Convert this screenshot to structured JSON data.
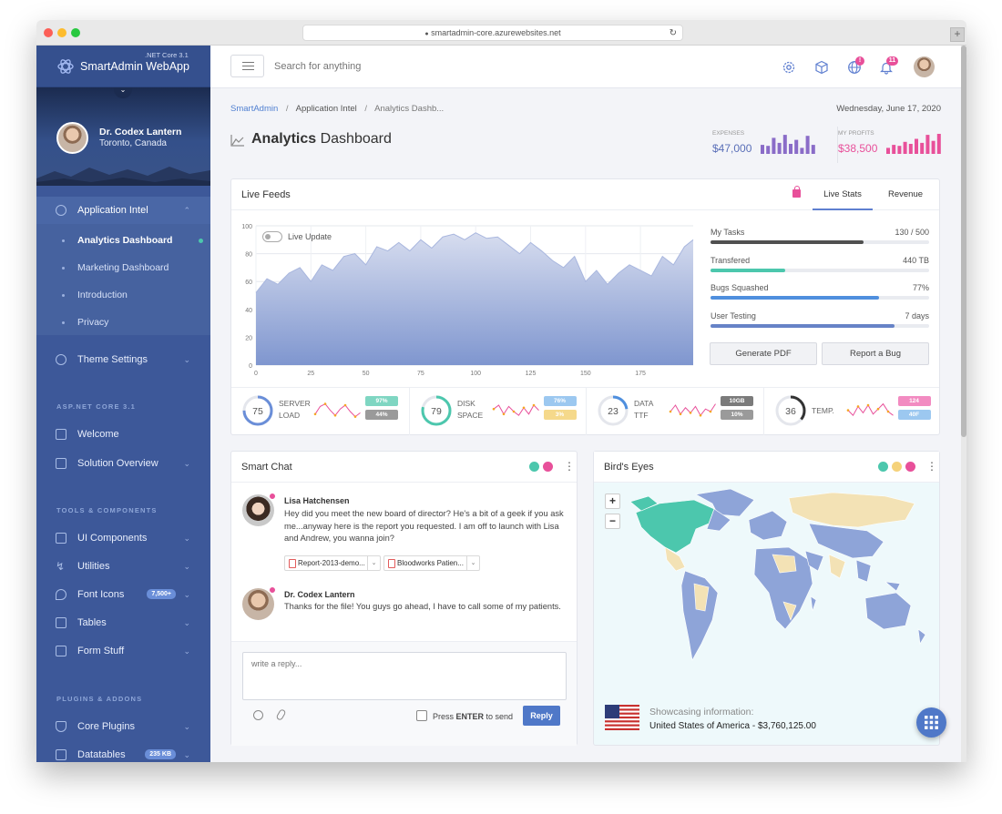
{
  "browser": {
    "url": "smartadmin-core.azurewebsites.net"
  },
  "app": {
    "name": "SmartAdmin WebApp",
    "version": ".NET Core 3.1"
  },
  "user": {
    "name": "Dr. Codex Lantern",
    "location": "Toronto, Canada"
  },
  "sidebar": {
    "app_intel": "Application Intel",
    "subs": [
      "Analytics Dashboard",
      "Marketing Dashboard",
      "Introduction",
      "Privacy"
    ],
    "theme": "Theme Settings",
    "section1": "ASP.NET CORE 3.1",
    "welcome": "Welcome",
    "solution": "Solution Overview",
    "section2": "TOOLS & COMPONENTS",
    "ui": "UI Components",
    "utilities": "Utilities",
    "fonticons": "Font Icons",
    "fonticons_badge": "7,500+",
    "tables": "Tables",
    "formstuff": "Form Stuff",
    "section3": "PLUGINS & ADDONS",
    "coreplugins": "Core Plugins",
    "datatables": "Datatables",
    "datatables_badge": "235 KB"
  },
  "topbar": {
    "search_placeholder": "Search for anything",
    "globe_badge": "!",
    "bell_badge": "11"
  },
  "breadcrumb": {
    "root": "SmartAdmin",
    "section": "Application Intel",
    "current": "Analytics Dashb..."
  },
  "date": "Wednesday, June 17, 2020",
  "page": {
    "title_bold": "Analytics",
    "title_light": "Dashboard"
  },
  "header_stats": {
    "expenses_label": "EXPENSES",
    "expenses_value": "$47,000",
    "expenses_color": "#8a6cc8",
    "profits_label": "MY PROFITS",
    "profits_value": "$38,500",
    "profits_color": "#e8509a",
    "expenses_bars": [
      0.45,
      0.4,
      0.8,
      0.55,
      0.95,
      0.5,
      0.7,
      0.3,
      0.9,
      0.45
    ],
    "profits_bars": [
      0.3,
      0.45,
      0.4,
      0.6,
      0.5,
      0.75,
      0.55,
      0.95,
      0.65,
      1.0
    ]
  },
  "livefeeds": {
    "title": "Live Feeds",
    "tab_stats": "Live Stats",
    "tab_revenue": "Revenue",
    "live_update": "Live Update",
    "stats": [
      {
        "label": "My Tasks",
        "value": "130 / 500",
        "pct": 0.7,
        "color": "#505050"
      },
      {
        "label": "Transfered",
        "value": "440 TB",
        "pct": 0.34,
        "color": "#4cc7ad"
      },
      {
        "label": "Bugs Squashed",
        "value": "77%",
        "pct": 0.77,
        "color": "#4f8fde"
      },
      {
        "label": "User Testing",
        "value": "7 days",
        "pct": 0.84,
        "color": "#6683c7"
      }
    ],
    "btn_pdf": "Generate PDF",
    "btn_bug": "Report a Bug"
  },
  "chart_data": {
    "type": "area",
    "x": [
      0,
      5,
      10,
      15,
      20,
      25,
      30,
      35,
      40,
      45,
      50,
      55,
      60,
      65,
      70,
      75,
      80,
      85,
      90,
      95,
      100,
      105,
      110,
      115,
      120,
      125,
      130,
      135,
      140,
      145,
      150,
      155,
      160,
      165,
      170,
      175,
      180,
      185,
      190,
      195,
      199
    ],
    "y": [
      52,
      62,
      58,
      66,
      70,
      60,
      72,
      68,
      78,
      80,
      72,
      85,
      82,
      88,
      82,
      90,
      84,
      92,
      94,
      90,
      95,
      91,
      92,
      86,
      80,
      88,
      82,
      75,
      70,
      78,
      60,
      68,
      58,
      66,
      72,
      68,
      64,
      78,
      72,
      85,
      90
    ],
    "ylim": [
      0,
      100
    ],
    "xlim": [
      0,
      199
    ],
    "yticks": [
      0,
      20,
      40,
      60,
      80,
      100
    ],
    "xticks": [
      0,
      25,
      50,
      75,
      100,
      125,
      150,
      175
    ]
  },
  "gauges": [
    {
      "value": "75",
      "label1": "SERVER",
      "label2": "LOAD",
      "color": "#6a8ed8",
      "tag1": "97%",
      "tag1c": "#7fd6c2",
      "tag2": "44%",
      "tag2c": "#9a9a9a",
      "pct": 0.75,
      "spark": [
        12,
        6,
        4,
        9,
        13,
        8,
        5,
        10,
        14,
        11
      ]
    },
    {
      "value": "79",
      "label1": "DISK",
      "label2": "SPACE",
      "color": "#4cc7ad",
      "tag1": "76%",
      "tag1c": "#9cc8f0",
      "tag2": "3%",
      "tag2c": "#f5d98b",
      "pct": 0.79,
      "spark": [
        8,
        5,
        12,
        6,
        10,
        13,
        7,
        12,
        5,
        9
      ]
    },
    {
      "value": "23",
      "label1": "DATA",
      "label2": "TTF",
      "color": "#4f8fde",
      "tag1": "10GB",
      "tag1c": "#7b7b7b",
      "tag2": "10%",
      "tag2c": "#9a9a9a",
      "pct": 0.23,
      "spark": [
        10,
        5,
        12,
        7,
        11,
        6,
        13,
        8,
        10,
        4
      ]
    },
    {
      "value": "36",
      "label1": "TEMP.",
      "label2": "",
      "color": "#333333",
      "tag1": "124",
      "tag1c": "#f28bc1",
      "tag2": "40F",
      "tag2c": "#9cc8f0",
      "pct": 0.36,
      "spark": [
        9,
        13,
        6,
        11,
        5,
        12,
        8,
        4,
        10,
        13
      ]
    }
  ],
  "chat": {
    "title": "Smart Chat",
    "messages": [
      {
        "name": "Lisa Hatchensen",
        "lines": [
          "Hey did you meet the new board of director? He's a bit of a geek if you ask",
          "me...anyway here is the report you requested. I am off to launch with Lisa",
          "and Andrew, you wanna join?"
        ]
      },
      {
        "name": "Dr. Codex Lantern",
        "lines": [
          "Thanks for the file! You guys go ahead, I have to call some of my patients."
        ]
      }
    ],
    "att1": "Report-2013-demo...",
    "att2": "Bloodworks Patien...",
    "placeholder": "write a reply...",
    "press_enter": "Press ENTER to send",
    "enter_word": "ENTER",
    "reply": "Reply"
  },
  "map": {
    "title": "Bird's Eyes",
    "showcase_label": "Showcasing information:",
    "showcase_value": "United States of America - $3,760,125.00"
  }
}
